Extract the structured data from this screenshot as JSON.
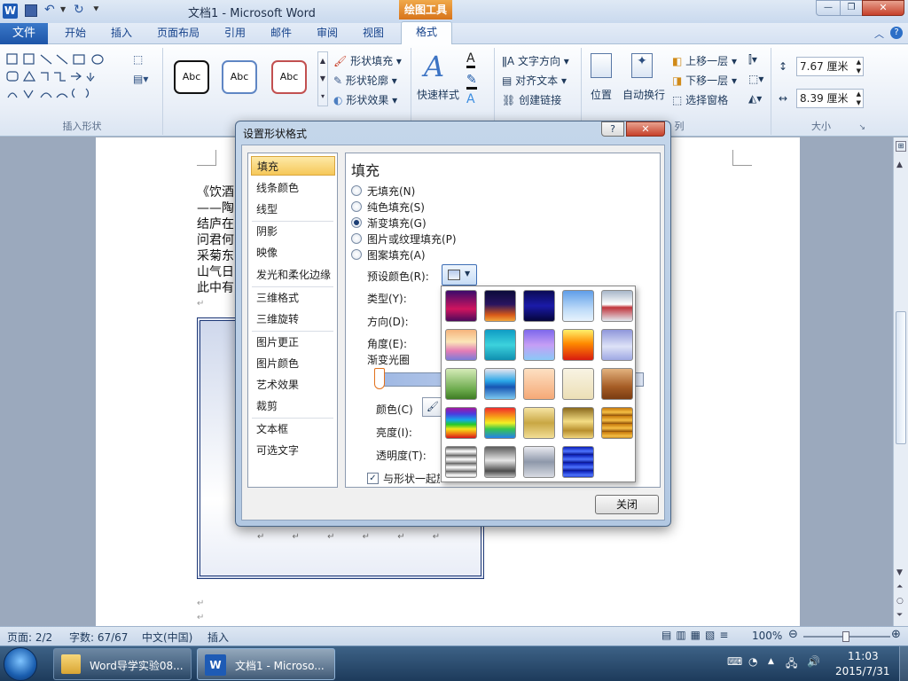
{
  "titlebar": {
    "app_icon_label": "W",
    "title": "文档1 - Microsoft Word",
    "context_tab": "绘图工具"
  },
  "menu": {
    "file": "文件",
    "tabs": [
      "开始",
      "插入",
      "页面布局",
      "引用",
      "邮件",
      "审阅",
      "视图",
      "格式"
    ]
  },
  "ribbon": {
    "insert_shapes_label": "插入形状",
    "style_samples": [
      "Abc",
      "Abc",
      "Abc"
    ],
    "shape_fill": "形状填充",
    "shape_outline": "形状轮廓",
    "shape_effects": "形状效果",
    "quick_styles": "快速样式",
    "text_direction": "文字方向",
    "align_text": "对齐文本",
    "create_link": "创建链接",
    "position": "位置",
    "wrap_text": "自动换行",
    "bring_forward": "上移一层",
    "send_backward": "下移一层",
    "selection_pane": "选择窗格",
    "arrange_label_partial": "列",
    "size_label": "大小",
    "height_value": "7.67 厘米",
    "width_value": "8.39 厘米"
  },
  "document": {
    "lines": [
      "《饮酒",
      "——陶",
      "结庐在",
      "问君何",
      "采菊东",
      "山气日",
      "此中有"
    ],
    "box_marks": "↵ ↵ ↵ ↵ ↵ ↵"
  },
  "dialog": {
    "title": "设置形状格式",
    "help": "?",
    "close_x": "✕",
    "nav": [
      "填充",
      "线条颜色",
      "线型",
      "阴影",
      "映像",
      "发光和柔化边缘",
      "三维格式",
      "三维旋转",
      "图片更正",
      "图片颜色",
      "艺术效果",
      "裁剪",
      "文本框",
      "可选文字"
    ],
    "selected_nav": "填充",
    "section_title": "填充",
    "options": [
      "无填充(N)",
      "纯色填充(S)",
      "渐变填充(G)",
      "图片或纹理填充(P)",
      "图案填充(A)"
    ],
    "selected_option": "渐变填充(G)",
    "preset_label": "预设颜色(R):",
    "type_label": "类型(Y):",
    "direction_label": "方向(D):",
    "angle_label": "角度(E):",
    "stops_label": "渐变光圈",
    "color_label": "颜色(C)",
    "brightness_label": "亮度(I):",
    "transparency_label": "透明度(T):",
    "rotate_label": "与形状一起旋转(W)",
    "rotate_checked": true,
    "close_button": "关闭"
  },
  "presets": [
    "linear-gradient(#3b0b6b,#d0145e 60%,#4b0a5c)",
    "linear-gradient(#0b0b3a,#2a1460 45%,#d85a18 80%,#f2a53a)",
    "linear-gradient(#0b0b55,#1a1aa8 50%,#05053a)",
    "linear-gradient(#5f9ee8,#bcdaf8 60%,#e8f3fd)",
    "linear-gradient(#a7b6c9,#ffffff 45%,#c0343b 55%,#e3e9f0)",
    "linear-gradient(#f6b47c,#fbe6b8 40%,#e37cb6 70%,#7a7cd8)",
    "linear-gradient(#0f9cc4,#3cd2dc 50%,#0f8fb0)",
    "linear-gradient(#7d68ec,#c59ef5 50%,#8ac9f7)",
    "linear-gradient(#fff06a,#ff8a00 45%,#d81b0f)",
    "linear-gradient(#8f97db,#dde2f7 55%,#9fa8e3)",
    "linear-gradient(#d5ebb8,#6aa94b 70%,#3e7c24)",
    "linear-gradient(#e8e6ef,#2aa7e8 40%,#1755b3 60%,#7cc8f0)",
    "linear-gradient(#fde0c2,#f5a977)",
    "linear-gradient(#f8f3e3,#ecdfb6)",
    "linear-gradient(#e2b27e,#a55c25 60%,#7a3c12)",
    "linear-gradient(#a2189f,#4a3be0 20%,#15a7e8 40%,#26c927 55%,#f3e617 70%,#f07e13 85%,#d5161c)",
    "linear-gradient(#f02c2c,#f7a018 30%,#f4ef24 50%,#37c74c 70%,#2680eb)",
    "linear-gradient(#f5e4a3,#c9a744 50%,#f2de94)",
    "linear-gradient(#8b6a1d,#f4dd84 45%,#b88f2d 75%,#f0d57c)",
    "repeating-linear-gradient(#c6780c 0px,#f6c045 5px,#8c4c05 9px)",
    "repeating-linear-gradient(#5a5a5a 0px,#ffffff 5px,#8c8c8c 9px)",
    "linear-gradient(#5c5c5c,#e6e6e6 45%,#4c4c4c 80%,#bdbdbd)",
    "linear-gradient(#e9eaf0,#8e98aa 50%,#d8dbe3)",
    "repeating-linear-gradient(#0a1db5 0px,#4d74ff 5px,#05108a 9px)"
  ],
  "status": {
    "page": "页面: 2/2",
    "words": "字数: 67/67",
    "language": "中文(中国)",
    "mode": "插入",
    "zoom": "100%"
  },
  "taskbar": {
    "item1": "Word导学实验08...",
    "item2": "文档1 - Microso...",
    "time": "11:03",
    "date": "2015/7/31"
  }
}
